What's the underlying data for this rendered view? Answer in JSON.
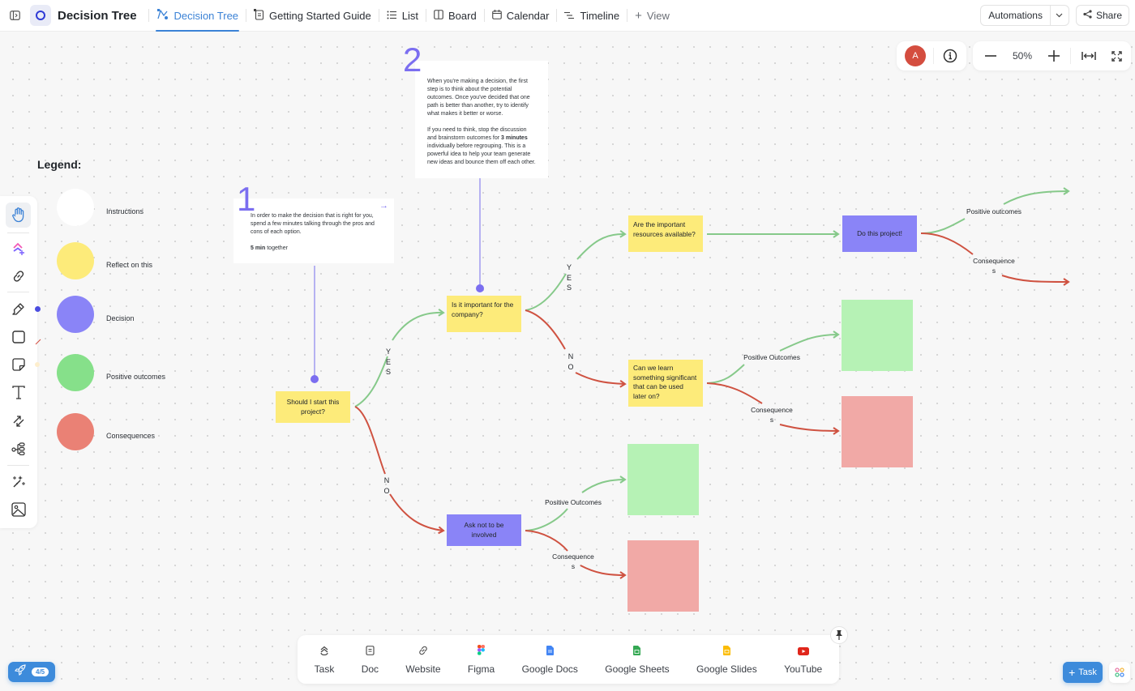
{
  "header": {
    "title": "Decision Tree",
    "tabs": [
      {
        "label": "Decision Tree",
        "icon": "whiteboard-icon",
        "active": true
      },
      {
        "label": "Getting Started Guide",
        "icon": "doc-icon",
        "active": false
      },
      {
        "label": "List",
        "icon": "list-icon",
        "active": false
      },
      {
        "label": "Board",
        "icon": "board-icon",
        "active": false
      },
      {
        "label": "Calendar",
        "icon": "calendar-icon",
        "active": false
      },
      {
        "label": "Timeline",
        "icon": "timeline-icon",
        "active": false
      }
    ],
    "add_view_label": "View",
    "automations_label": "Automations",
    "share_label": "Share"
  },
  "canvas_controls": {
    "avatar_initial": "A",
    "zoom_level": "50%"
  },
  "legend": {
    "title": "Legend:",
    "items": [
      {
        "label": "Instructions",
        "color": "#ffffff"
      },
      {
        "label": "Reflect on this",
        "color": "#fdeb7a"
      },
      {
        "label": "Decision",
        "color": "#8a84f7"
      },
      {
        "label": "Positive outcomes",
        "color": "#86e08a"
      },
      {
        "label": "Consequences",
        "color": "#ea8175"
      }
    ]
  },
  "notes": {
    "step1": {
      "number": "1",
      "text": "In order to make the decision that is right for you, spend a few minutes talking through the pros and cons of each option.",
      "time_bold": "5 min",
      "time_rest": " together"
    },
    "step2": {
      "number": "2",
      "para1": "When you're making a decision, the first step is to think about the potential outcomes. Once you've decided that one path is better than another, try to identify what makes it better or worse.",
      "para2_a": "If you need to think, stop the discussion and brainstorm outcomes for ",
      "para2_bold": "3 minutes",
      "para2_b": " individually before regrouping. This is a powerful idea to help your team generate new ideas and bounce them off each other."
    }
  },
  "tree": {
    "start": "Should I start this project?",
    "important": "Is it important for the company?",
    "resources": "Are the important resources available?",
    "learn": "Can we learn something significant that can be used later on?",
    "do_project": "Do this project!",
    "ask_not": "Ask not to be involved",
    "labels": {
      "yes": "YES",
      "no": "NO",
      "positive_lower": "Positive outcomes",
      "positive_upper": "Positive Outcomes",
      "consequences_a": "Consequence",
      "consequences_b": "s"
    },
    "colors": {
      "yes_line": "#86c98a",
      "no_line": "#cf5241",
      "instruction_line": "#8b84ee"
    }
  },
  "dock": {
    "items": [
      {
        "label": "Task"
      },
      {
        "label": "Doc"
      },
      {
        "label": "Website"
      },
      {
        "label": "Figma"
      },
      {
        "label": "Google Docs"
      },
      {
        "label": "Google Sheets"
      },
      {
        "label": "Google Slides"
      },
      {
        "label": "YouTube"
      }
    ]
  },
  "footer": {
    "onboarding_progress": "4/5",
    "task_button_label": "Task"
  },
  "colors": {
    "accent": "#3b82d6",
    "yellow": "#fdeb7a",
    "purple": "#8a84f7",
    "green_box": "#b6f2b5",
    "red_box": "#f1a9a6"
  }
}
